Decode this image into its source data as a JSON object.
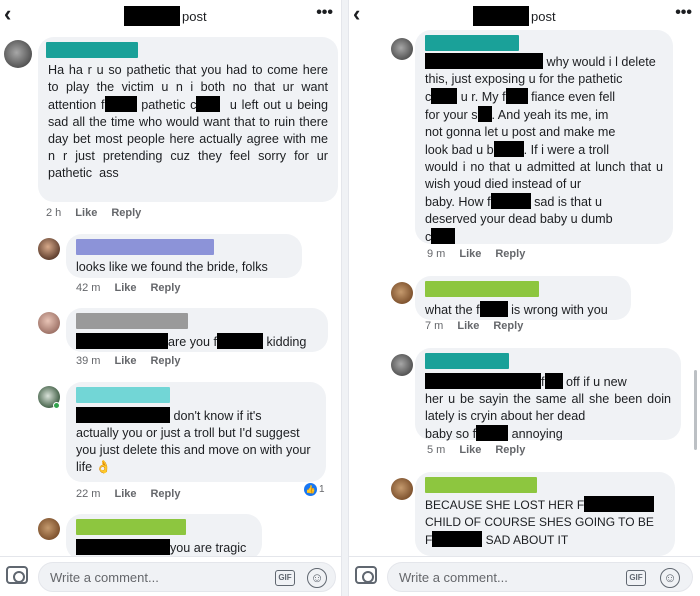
{
  "left": {
    "title": "post",
    "composer_placeholder": "Write a comment...",
    "gif_label": "GIF",
    "comments": [
      {
        "text": "Ha ha r u so pathetic that you had to come here to play the victim u n i both no that ur want attention f",
        "text2": " pathetic c",
        "text3": "  u left out u being sad all the time who would want that to ruin there day bet most people here actually agree with me n r just pretending cuz they feel sorry for ur pathetic  ass",
        "time": "2 h",
        "like": "Like",
        "reply": "Reply",
        "name_color": "#1aa199"
      },
      {
        "text": "looks like we found the bride, folks",
        "time": "42 m",
        "like": "Like",
        "reply": "Reply",
        "name_color": "#8c93d8"
      },
      {
        "text_a": "are you f",
        "text_b": " kidding",
        "time": "39 m",
        "like": "Like",
        "reply": "Reply",
        "name_color": "#9a9a9a"
      },
      {
        "text_a": " don't know if it's",
        "text_b": "actually you or just a troll but I'd suggest you just delete this and move on with your life 👌",
        "time": "22 m",
        "like": "Like",
        "reply": "Reply",
        "reaction_count": "1",
        "name_color": "#72d6d6"
      },
      {
        "text": "you are tragic",
        "name_color": "#8dc63f"
      }
    ]
  },
  "right": {
    "title": "post",
    "composer_placeholder": "Write a comment...",
    "gif_label": "GIF",
    "comments": [
      {
        "line1": " why would i l delete",
        "body1": "this, just exposing u for the pathetic",
        "body2a": "c",
        "body2b": " u r. My f",
        "body2c": " fiance even fell",
        "body3a": "for your s",
        "body3b": ". And yeah its me, im",
        "body4": "not gonna let u post and make me",
        "body5a": "look bad u b",
        "body5b": ". If i were a troll",
        "body6": "would i no that u admitted at lunch that u wish youd died instead of ur",
        "body8a": "baby. How f",
        "body8b": " sad is that u",
        "body9": "deserved your dead baby u dumb",
        "body10": "c",
        "time": "9 m",
        "like": "Like",
        "reply": "Reply",
        "name_color": "#1aa199"
      },
      {
        "text_a": "what the f",
        "text_b": " is wrong with you",
        "time": "7 m",
        "like": "Like",
        "reply": "Reply",
        "name_color": "#8dc63f"
      },
      {
        "line1": "f",
        "line1b": " off if u new",
        "body": "her u be sayin the same all she been doin lately is cryin about her dead",
        "last_a": "baby so f",
        "last_b": " annoying",
        "time": "5 m",
        "like": "Like",
        "reply": "Reply",
        "name_color": "#1aa199"
      },
      {
        "line1": "BECAUSE SHE LOST HER F",
        "line2": "CHILD OF COURSE SHES GOING TO BE",
        "line3a": "F",
        "line3b": " SAD ABOUT IT",
        "name_color": "#8dc63f"
      }
    ]
  }
}
